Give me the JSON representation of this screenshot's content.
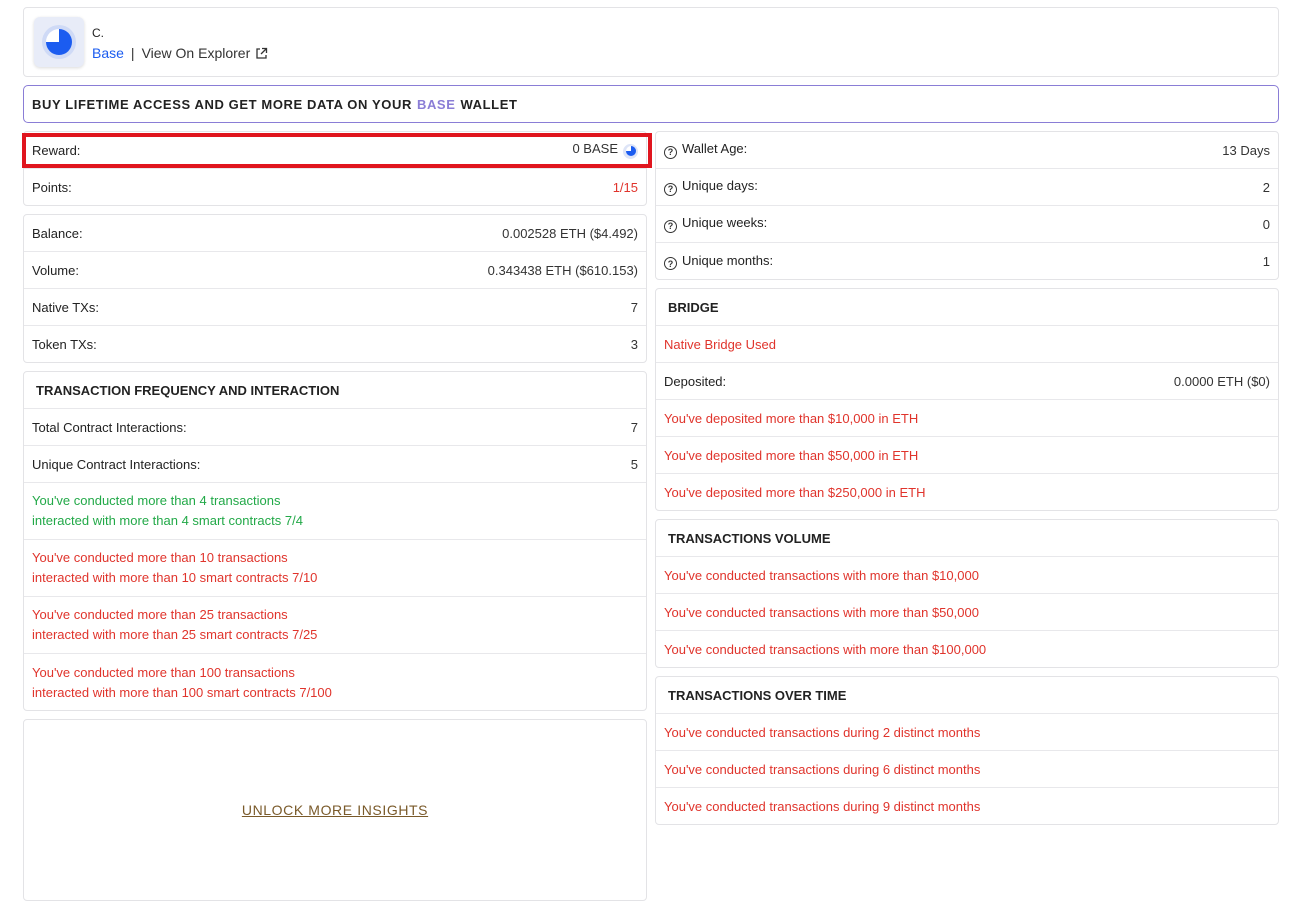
{
  "header": {
    "wallet_name": "C.",
    "network_link": "Base",
    "separator": "|",
    "explorer_link": "View On Explorer"
  },
  "banner": {
    "text_before": "BUY LIFETIME ACCESS AND GET MORE DATA ON YOUR",
    "highlight": "BASE",
    "text_after": "WALLET"
  },
  "reward_card": {
    "reward_label": "Reward:",
    "reward_value": "0 BASE",
    "points_label": "Points:",
    "points_value": "1/15"
  },
  "stats_card": {
    "rows": [
      {
        "label": "Balance:",
        "value": "0.002528 ETH ($4.492)"
      },
      {
        "label": "Volume:",
        "value": "0.343438 ETH ($610.153)"
      },
      {
        "label": "Native TXs:",
        "value": "7"
      },
      {
        "label": "Token TXs:",
        "value": "3"
      }
    ]
  },
  "frequency": {
    "title": "TRANSACTION FREQUENCY AND INTERACTION",
    "total_label": "Total Contract Interactions:",
    "total_value": "7",
    "unique_label": "Unique Contract Interactions:",
    "unique_value": "5",
    "milestones": [
      {
        "line1": "You've conducted more than 4 transactions",
        "line2": "interacted with more than 4 smart contracts 7/4",
        "status": "done"
      },
      {
        "line1": "You've conducted more than 10 transactions",
        "line2": "interacted with more than 10 smart contracts 7/10",
        "status": "pending"
      },
      {
        "line1": "You've conducted more than 25 transactions",
        "line2": "interacted with more than 25 smart contracts 7/25",
        "status": "pending"
      },
      {
        "line1": "You've conducted more than 100 transactions",
        "line2": "interacted with more than 100 smart contracts 7/100",
        "status": "pending"
      }
    ]
  },
  "unlock": {
    "label": "UNLOCK MORE INSIGHTS"
  },
  "age_card": {
    "rows": [
      {
        "label": "Wallet Age:",
        "value": "13 Days"
      },
      {
        "label": "Unique days:",
        "value": "2"
      },
      {
        "label": "Unique weeks:",
        "value": "0"
      },
      {
        "label": "Unique months:",
        "value": "1"
      }
    ]
  },
  "bridge": {
    "title": "BRIDGE",
    "native_used": "Native Bridge Used",
    "deposited_label": "Deposited:",
    "deposited_value": "0.0000 ETH ($0)",
    "milestones": [
      "You've deposited more than $10,000 in ETH",
      "You've deposited more than $50,000 in ETH",
      "You've deposited more than $250,000 in ETH"
    ]
  },
  "volume": {
    "title": "TRANSACTIONS VOLUME",
    "milestones": [
      "You've conducted transactions with more than $10,000",
      "You've conducted transactions with more than $50,000",
      "You've conducted transactions with more than $100,000"
    ]
  },
  "over_time": {
    "title": "TRANSACTIONS OVER TIME",
    "milestones": [
      "You've conducted transactions during 2 distinct months",
      "You've conducted transactions during 6 distinct months",
      "You've conducted transactions during 9 distinct months"
    ]
  },
  "colors": {
    "done": "#22a948",
    "pending": "#e0342c",
    "accent": "#8a7dd6",
    "link": "#1b5cf0",
    "highlight_box": "#e0151e"
  }
}
